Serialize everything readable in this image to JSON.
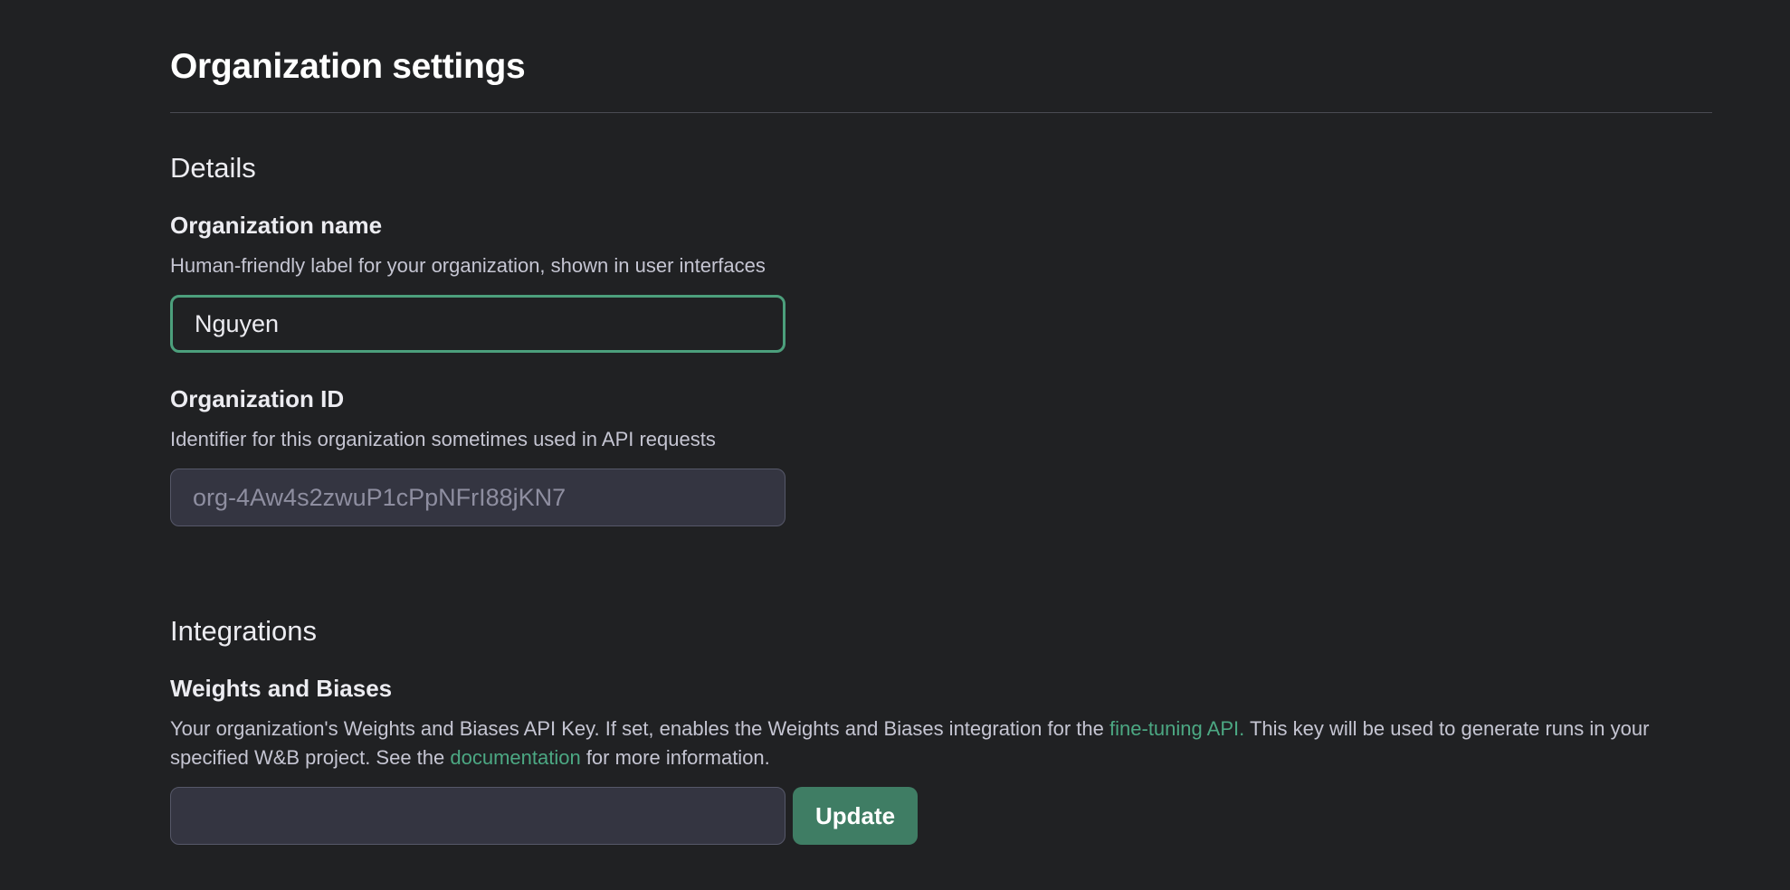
{
  "page": {
    "title": "Organization settings"
  },
  "details": {
    "heading": "Details",
    "org_name": {
      "label": "Organization name",
      "description": "Human-friendly label for your organization, shown in user interfaces",
      "value": "Nguyen"
    },
    "org_id": {
      "label": "Organization ID",
      "description": "Identifier for this organization sometimes used in API requests",
      "value": "org-4Aw4s2zwuP1cPpNFrI88jKN7"
    }
  },
  "integrations": {
    "heading": "Integrations",
    "wandb": {
      "label": "Weights and Biases",
      "desc_part1": "Your organization's Weights and Biases API Key. If set, enables the Weights and Biases integration for the ",
      "link1": "fine-tuning API.",
      "desc_part2": " This key will be used to generate runs in your specified W&B project. See the ",
      "link2": "documentation",
      "desc_part3": " for more information.",
      "api_key_value": "",
      "update_label": "Update"
    }
  },
  "colors": {
    "background": "#202123",
    "accent_green": "#4c9f7c",
    "button_green": "#3f7d64",
    "link_green": "#4ca883"
  }
}
